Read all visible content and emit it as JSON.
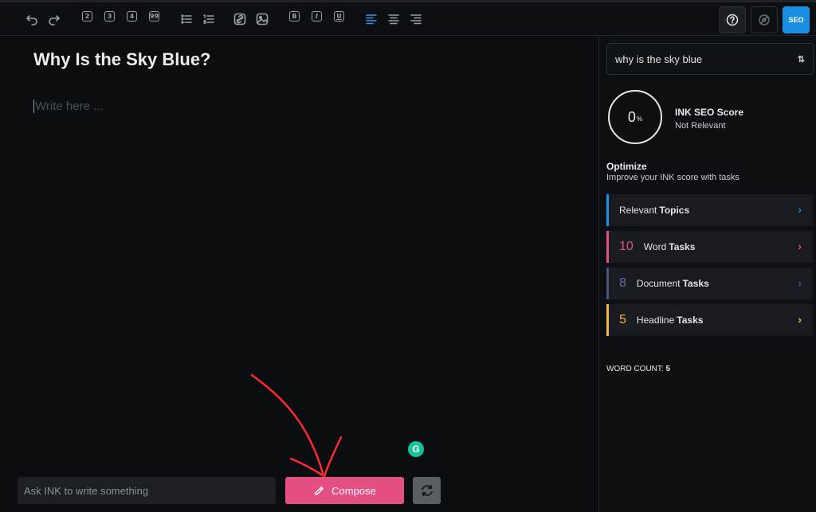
{
  "document": {
    "title": "Why Is the Sky Blue?",
    "body_placeholder": "Write here ..."
  },
  "toolbar": {
    "icons": [
      "undo-icon",
      "redo-icon",
      "heading-2-icon",
      "heading-3-icon",
      "heading-4-icon",
      "quote-icon",
      "bullet-list-icon",
      "numbered-list-icon",
      "link-icon",
      "image-icon",
      "bold-icon",
      "italic-icon",
      "underline-icon",
      "align-left-icon",
      "align-center-icon",
      "align-right-icon"
    ],
    "heading_labels": [
      "2",
      "3",
      "4",
      "99"
    ],
    "format_labels": [
      "B",
      "I",
      "U"
    ],
    "seo_label": "SEO",
    "active_color": "#3b8fe0"
  },
  "bottom": {
    "ask_placeholder": "Ask INK to write something",
    "compose_label": "Compose",
    "compose_color": "#e54f85"
  },
  "sidebar": {
    "keyword": "why is the sky blue",
    "score": {
      "value": "0",
      "unit": "%",
      "title": "INK SEO Score",
      "status": "Not Relevant"
    },
    "optimize": {
      "title": "Optimize",
      "subtitle": "Improve your INK score with tasks"
    },
    "tasks": [
      {
        "count": "",
        "label": "Relevant",
        "bold": "Topics",
        "color": "#1a8fe3"
      },
      {
        "count": "10",
        "label": "Word",
        "bold": "Tasks",
        "color": "#e54f85"
      },
      {
        "count": "8",
        "label": "Document",
        "bold": "Tasks",
        "color": "#4a4f7a"
      },
      {
        "count": "5",
        "label": "Headline",
        "bold": "Tasks",
        "color": "#f5b82e"
      }
    ],
    "word_count_label": "WORD COUNT:",
    "word_count_value": "5"
  }
}
